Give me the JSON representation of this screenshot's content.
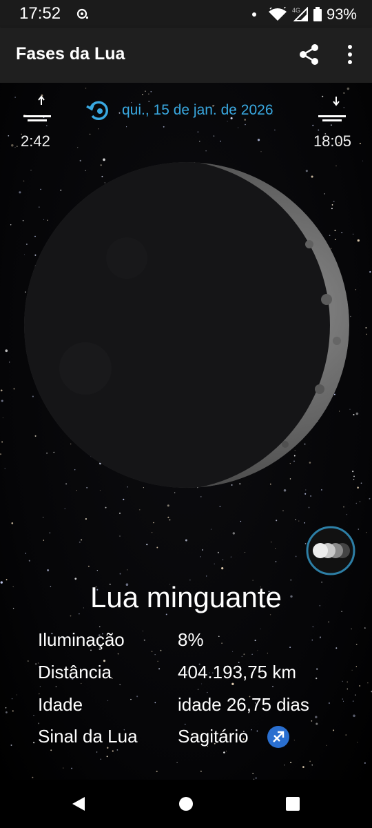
{
  "status_bar": {
    "time": "17:52",
    "network": "4G",
    "battery": "93%"
  },
  "app_bar": {
    "title": "Fases da Lua",
    "icons": [
      "share-icon",
      "more-vert-icon"
    ]
  },
  "moon_times": {
    "moonrise": "2:42",
    "moonset": "18:05",
    "date": "qui., 15 de jan. de 2026",
    "accent_color": "#39a8e0"
  },
  "moon": {
    "phase_name": "Lua minguante",
    "illumination_fraction": 0.08
  },
  "info": {
    "illumination_label": "Iluminação",
    "illumination_value": "8%",
    "distance_label": "Distância",
    "distance_value": "404.193,75 km",
    "age_label": "Idade",
    "age_value": "idade 26,75 dias",
    "sign_label": "Sinal da Lua",
    "sign_value": "Sagitário",
    "sign_icon": "sagittarius-icon"
  },
  "nav_bar": {
    "icons": [
      "back-icon",
      "home-icon",
      "recents-icon"
    ]
  }
}
